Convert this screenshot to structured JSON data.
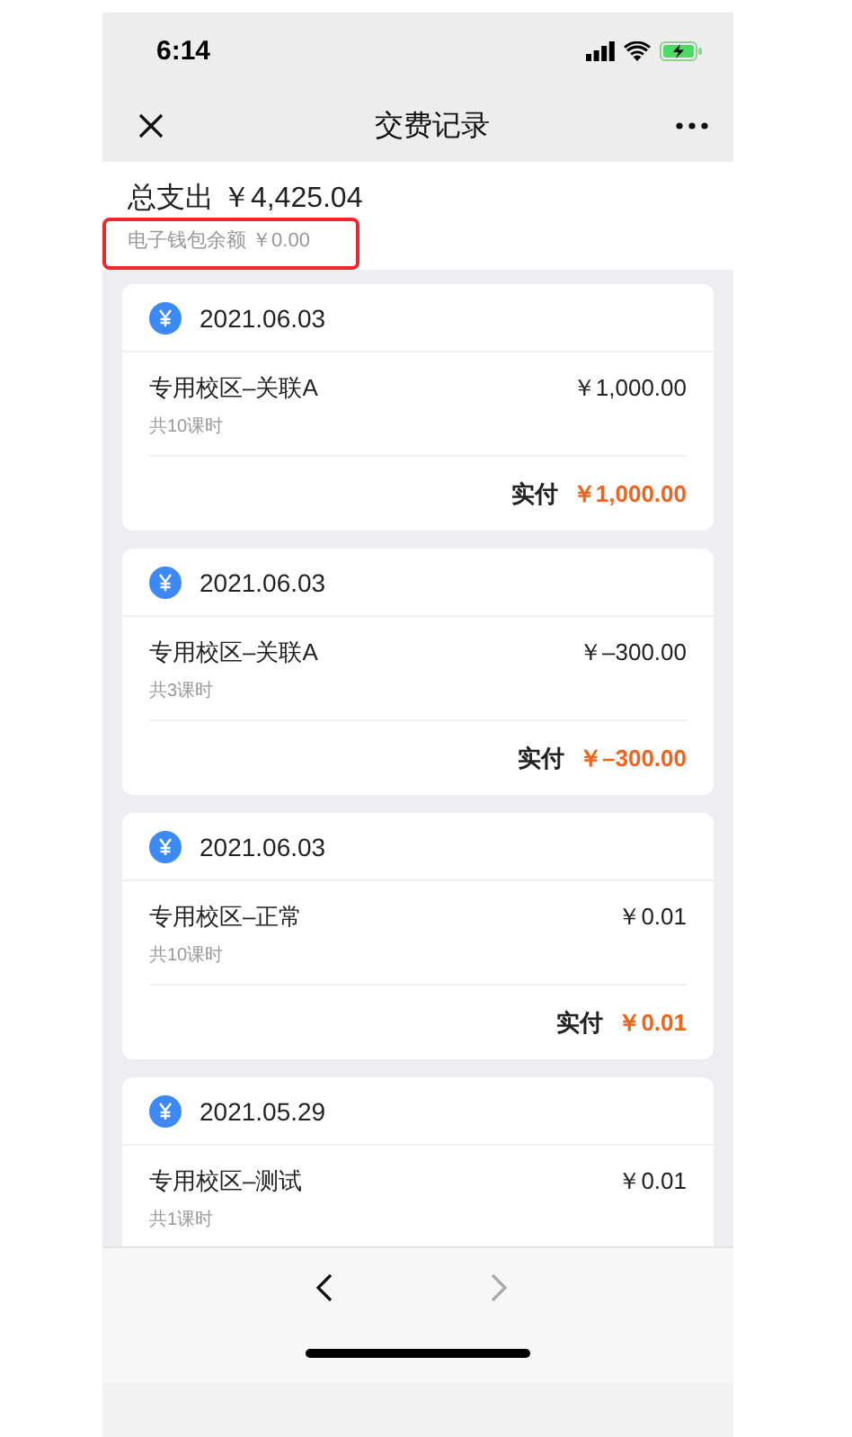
{
  "status_bar": {
    "time": "6:14"
  },
  "nav_bar": {
    "title": "交费记录"
  },
  "summary": {
    "total": "总支出 ￥4,425.04",
    "wallet": "电子钱包余额 ￥0.00",
    "highlighted": true
  },
  "records": [
    {
      "date": "2021.06.03",
      "item": "专用校区–关联A",
      "price": "￥1,000.00",
      "lessons": "共10课时",
      "paid_label": "实付",
      "paid": "￥1,000.00"
    },
    {
      "date": "2021.06.03",
      "item": "专用校区–关联A",
      "price": "￥–300.00",
      "lessons": "共3课时",
      "paid_label": "实付",
      "paid": "￥–300.00"
    },
    {
      "date": "2021.06.03",
      "item": "专用校区–正常",
      "price": "￥0.01",
      "lessons": "共10课时",
      "paid_label": "实付",
      "paid": "￥0.01"
    },
    {
      "date": "2021.05.29",
      "item": "专用校区–测试",
      "price": "￥0.01",
      "lessons": "共1课时"
    }
  ],
  "toolbar": {
    "back_disabled": false,
    "forward_disabled": true
  }
}
